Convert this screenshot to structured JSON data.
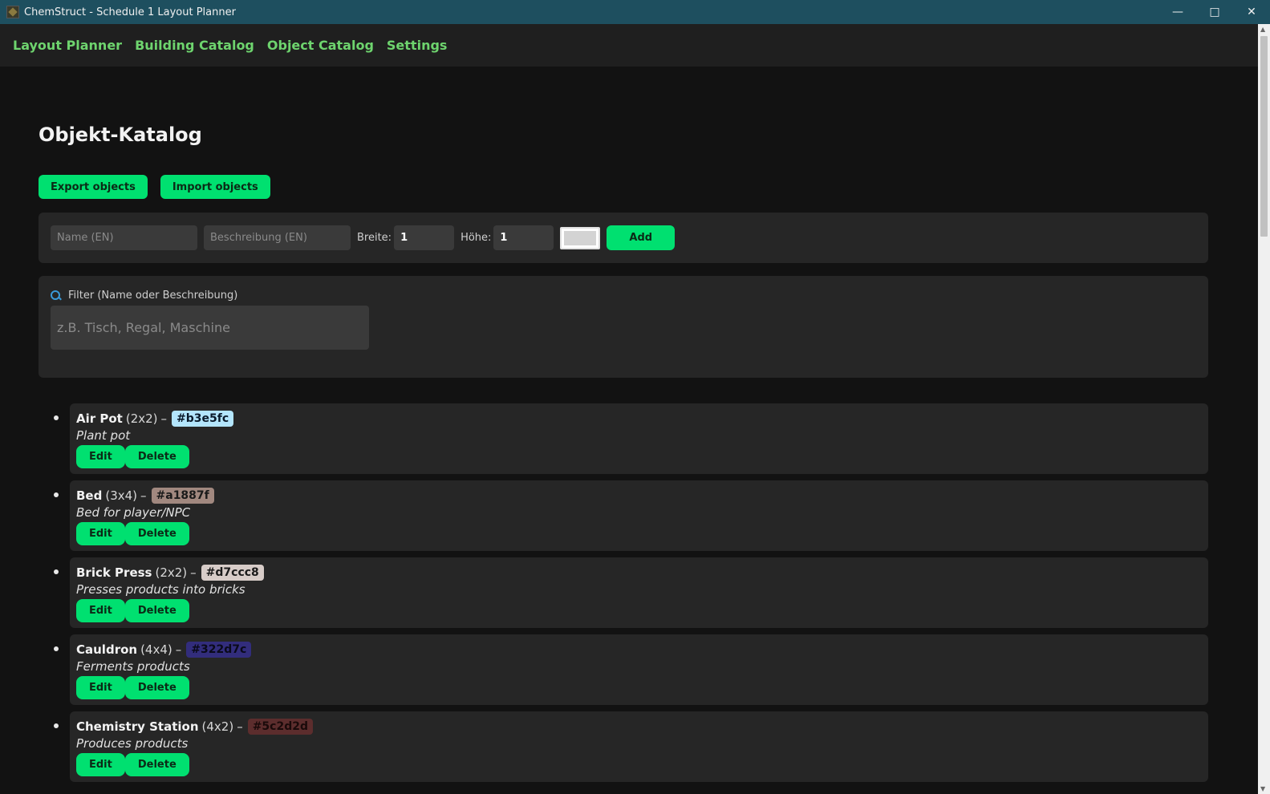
{
  "window": {
    "title": "ChemStruct - Schedule 1 Layout Planner"
  },
  "nav": [
    {
      "label": "Layout Planner"
    },
    {
      "label": "Building Catalog"
    },
    {
      "label": "Object Catalog"
    },
    {
      "label": "Settings"
    }
  ],
  "page": {
    "title": "Objekt-Katalog"
  },
  "actions": {
    "export_label": "Export objects",
    "import_label": "Import objects"
  },
  "add_form": {
    "name_placeholder": "Name (EN)",
    "desc_placeholder": "Beschreibung (EN)",
    "width_label": "Breite:",
    "width_value": "1",
    "height_label": "Höhe:",
    "height_value": "1",
    "color_value": "#d3d3d3",
    "add_label": "Add"
  },
  "filter": {
    "label": "Filter (Name oder Beschreibung)",
    "placeholder": "z.B. Tisch, Regal, Maschine"
  },
  "objects": [
    {
      "name": "Air Pot",
      "size": "(2x2)",
      "dash": "–",
      "color": "#b3e5fc",
      "desc": "Plant pot",
      "text_color": "#0a1a2a"
    },
    {
      "name": "Bed",
      "size": "(3x4)",
      "dash": "–",
      "color": "#a1887f",
      "desc": "Bed for player/NPC",
      "text_color": "#1a1a1a"
    },
    {
      "name": "Brick Press",
      "size": "(2x2)",
      "dash": "–",
      "color": "#d7ccc8",
      "desc": "Presses products into bricks",
      "text_color": "#1a1a1a"
    },
    {
      "name": "Cauldron",
      "size": "(4x4)",
      "dash": "–",
      "color": "#322d7c",
      "desc": "Ferments products",
      "text_color": "#0a0a1a"
    },
    {
      "name": "Chemistry Station",
      "size": "(4x2)",
      "dash": "–",
      "color": "#5c2d2d",
      "desc": "Produces products",
      "text_color": "#1a0a0a"
    }
  ],
  "item_buttons": {
    "edit_label": "Edit",
    "delete_label": "Delete"
  }
}
